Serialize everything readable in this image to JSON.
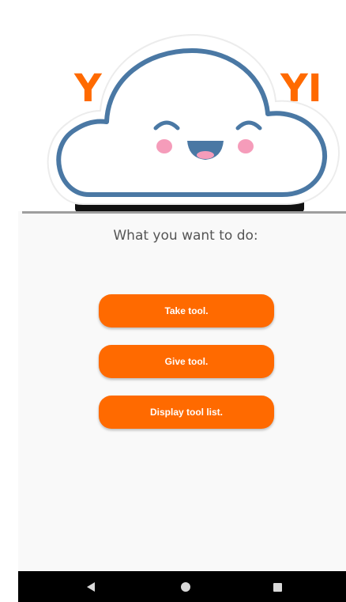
{
  "header": {
    "brand_left": "Y",
    "brand_right": "YI",
    "mascot": "cloud-face-mascot"
  },
  "main": {
    "prompt": "What you want to do:",
    "buttons": [
      {
        "id": "take",
        "label": "Take tool."
      },
      {
        "id": "give",
        "label": "Give tool."
      },
      {
        "id": "display",
        "label": "Display tool list."
      }
    ]
  },
  "navbar": {
    "icons": [
      "back-icon",
      "home-icon",
      "recents-icon"
    ]
  },
  "colors": {
    "accent": "#ff6a00",
    "cloud_outline": "#4a78a4",
    "cheek": "#f59cba",
    "navbar": "#000000"
  }
}
